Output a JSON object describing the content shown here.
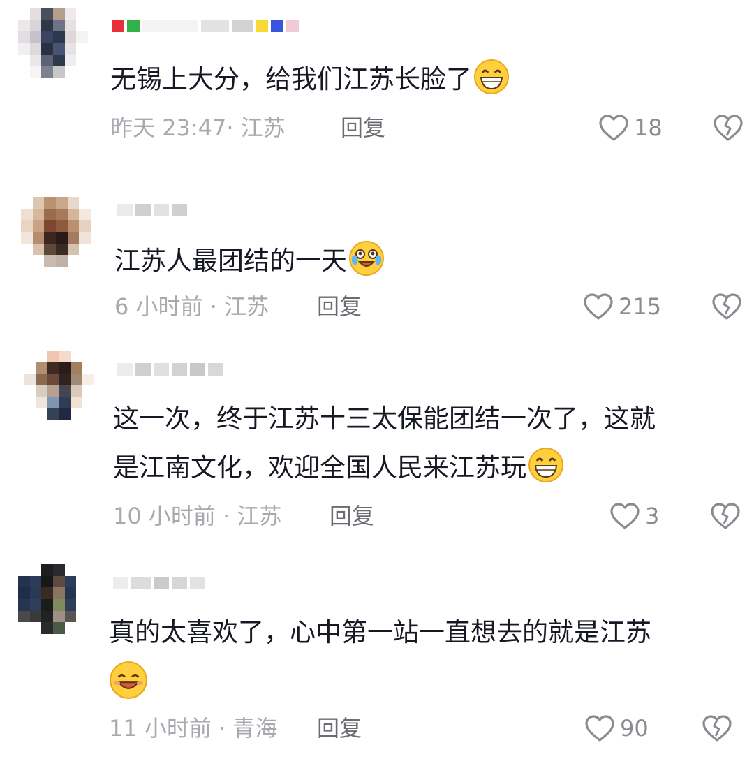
{
  "comments": [
    {
      "text": "无锡上大分，给我们江苏长脸了",
      "emoji": "grinning-face-emoji",
      "time": "昨天 23:47",
      "location": "江苏",
      "reply_label": "回复",
      "likes": "18",
      "like_icon": "heart-outline-icon",
      "dislike_icon": "broken-heart-icon"
    },
    {
      "text": "江苏人最团结的一天",
      "emoji": "tears-of-joy-emoji",
      "time": "6 小时前",
      "location": "江苏",
      "reply_label": "回复",
      "likes": "215",
      "like_icon": "heart-outline-icon",
      "dislike_icon": "broken-heart-icon"
    },
    {
      "text_line1": "这一次，终于江苏十三太保能团结一次了，这就",
      "text_line2": "是江南文化，欢迎全国人民来江苏玩",
      "emoji": "grinning-face-emoji",
      "time": "10 小时前",
      "location": "江苏",
      "reply_label": "回复",
      "likes": "3",
      "like_icon": "heart-outline-icon",
      "dislike_icon": "broken-heart-icon"
    },
    {
      "text": "真的太喜欢了，心中第一站一直想去的就是江苏",
      "emoji": "smiling-face-emoji",
      "time": "11 小时前",
      "location": "青海",
      "reply_label": "回复",
      "likes": "90",
      "like_icon": "heart-outline-icon",
      "dislike_icon": "broken-heart-icon"
    }
  ],
  "colors": {
    "text": "#161823",
    "meta": "#a8a9ae",
    "reply": "#6b6c72",
    "icon": "#8a8b91"
  }
}
